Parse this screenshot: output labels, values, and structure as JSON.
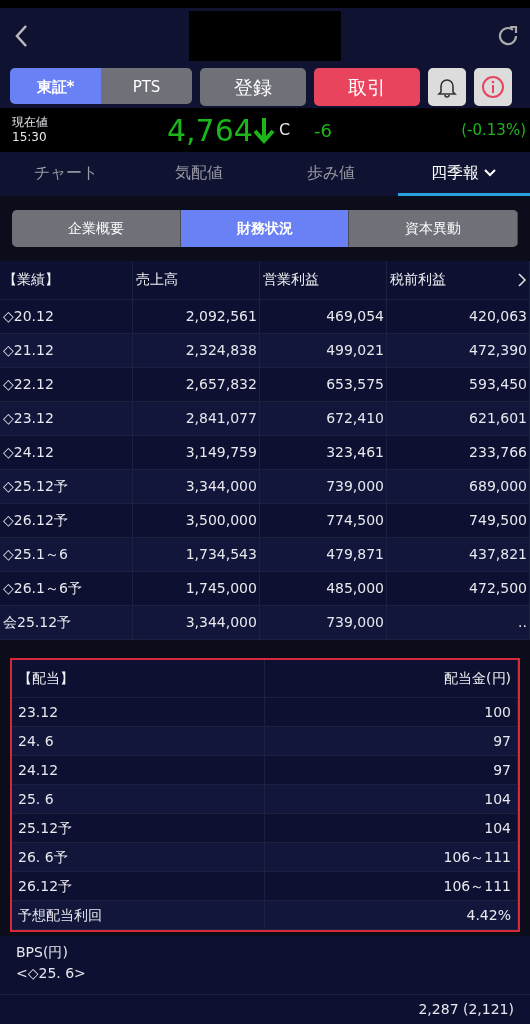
{
  "markets": [
    {
      "label": "東証*",
      "selected": true
    },
    {
      "label": "PTS",
      "selected": false
    }
  ],
  "register_button": "登録",
  "trade_button": "取引",
  "price": {
    "label": "現在値",
    "time": "15:30",
    "value": "4,764",
    "flag": "C",
    "change": "-6",
    "change_pct": "(-0.13%)"
  },
  "tabs": [
    {
      "label": "チャート",
      "selected": false
    },
    {
      "label": "気配値",
      "selected": false
    },
    {
      "label": "歩み値",
      "selected": false
    },
    {
      "label": "四季報",
      "selected": true
    }
  ],
  "segments": [
    {
      "label": "企業概要",
      "selected": false
    },
    {
      "label": "財務状況",
      "selected": true
    },
    {
      "label": "資本異動",
      "selected": false
    }
  ],
  "results_table": {
    "columns": [
      "【業績】",
      "売上高",
      "営業利益",
      "税前利益"
    ],
    "rows": [
      [
        "◇20.12",
        "2,092,561",
        "469,054",
        "420,063"
      ],
      [
        "◇21.12",
        "2,324,838",
        "499,021",
        "472,390"
      ],
      [
        "◇22.12",
        "2,657,832",
        "653,575",
        "593,450"
      ],
      [
        "◇23.12",
        "2,841,077",
        "672,410",
        "621,601"
      ],
      [
        "◇24.12",
        "3,149,759",
        "323,461",
        "233,766"
      ],
      [
        "◇25.12予",
        "3,344,000",
        "739,000",
        "689,000"
      ],
      [
        "◇26.12予",
        "3,500,000",
        "774,500",
        "749,500"
      ],
      [
        "◇25.1～6",
        "1,734,543",
        "479,871",
        "437,821"
      ],
      [
        "◇26.1～6予",
        "1,745,000",
        "485,000",
        "472,500"
      ],
      [
        "会25.12予",
        "3,344,000",
        "739,000",
        ".."
      ]
    ]
  },
  "dividend_table": {
    "columns": [
      "【配当】",
      "配当金(円)"
    ],
    "rows": [
      [
        "23.12",
        "100"
      ],
      [
        "24. 6",
        "97"
      ],
      [
        "24.12",
        "97"
      ],
      [
        "25. 6",
        "104"
      ],
      [
        "25.12予",
        "104"
      ],
      [
        "26. 6予",
        "106～111"
      ],
      [
        "26.12予",
        "106～111"
      ],
      [
        "予想配当利回",
        "4.42%"
      ]
    ]
  },
  "bps": {
    "label": "BPS(円)",
    "period": "<◇25. 6>",
    "value": "2,287 (2,121)"
  }
}
